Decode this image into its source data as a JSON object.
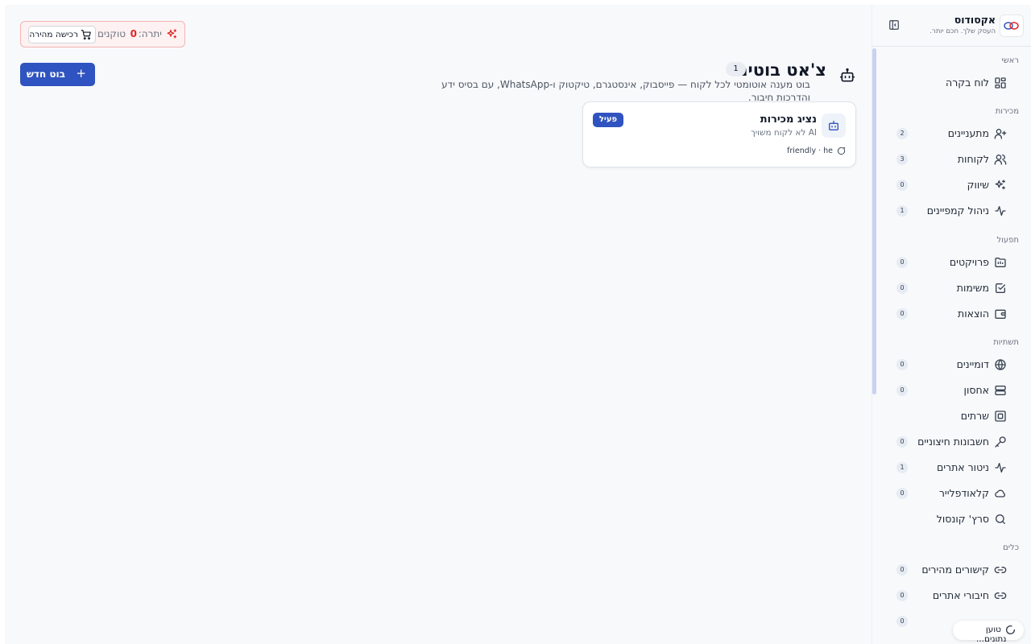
{
  "brand": {
    "name": "אקסודוס",
    "tagline": "העסק שלך. חכם יותר."
  },
  "token_bar": {
    "label": "יתרה:",
    "count": "0",
    "unit": "טוקנים",
    "buy_label": "רכישה מהירה"
  },
  "page": {
    "title": "צ'אט בוטים",
    "count_badge": "1",
    "description": "בוט מענה אוטומטי לכל לקוח — פייסבוק, אינסטגרם, טיקטוק ו-WhatsApp, עם בסיס ידע והדרכות חיבור.",
    "new_button_label": "בוט חדש"
  },
  "bot_card": {
    "name": "נציג מכירות",
    "subtitle": "AI לא לקוח משויך",
    "meta": "friendly · he",
    "status": "פעיל"
  },
  "sidebar": {
    "sections": [
      {
        "title": "ראשי"
      },
      {
        "title": "מכירות"
      },
      {
        "title": "תפעול"
      },
      {
        "title": "תשתיות"
      },
      {
        "title": "כלים"
      }
    ],
    "items": [
      {
        "label": "לוח בקרה",
        "icon": "dashboard-icon",
        "badge": ""
      },
      {
        "label": "מתעניינים",
        "icon": "user-plus-icon",
        "badge": "2"
      },
      {
        "label": "לקוחות",
        "icon": "users-icon",
        "badge": "3"
      },
      {
        "label": "שיווק",
        "icon": "sparkles-icon",
        "badge": "0"
      },
      {
        "label": "ניהול קמפיינים",
        "icon": "activity-icon",
        "badge": "1"
      },
      {
        "label": "פרויקטים",
        "icon": "folder-icon",
        "badge": "0"
      },
      {
        "label": "משימות",
        "icon": "check-square-icon",
        "badge": "0"
      },
      {
        "label": "הוצאות",
        "icon": "wallet-icon",
        "badge": "0"
      },
      {
        "label": "דומיינים",
        "icon": "globe-icon",
        "badge": "0"
      },
      {
        "label": "אחסון",
        "icon": "server-icon",
        "badge": "0"
      },
      {
        "label": "שרתים",
        "icon": "cpu-icon",
        "badge": ""
      },
      {
        "label": "חשבונות חיצוניים",
        "icon": "key-icon",
        "badge": "0"
      },
      {
        "label": "ניטור אתרים",
        "icon": "pulse-icon",
        "badge": "1"
      },
      {
        "label": "קלאודפלייר",
        "icon": "cloud-icon",
        "badge": "0"
      },
      {
        "label": "סרץ' קונסול",
        "icon": "search-icon",
        "badge": ""
      },
      {
        "label": "קישורים מהירים",
        "icon": "link-icon",
        "badge": "0"
      },
      {
        "label": "חיבורי אתרים",
        "icon": "link-icon",
        "badge": "0"
      }
    ],
    "extra_badge": "0"
  },
  "loading": {
    "label": "טוען",
    "sub": "נתונים..."
  },
  "colors": {
    "accent": "#2f53c0",
    "danger": "#dc2626",
    "badge_bg": "#e7ebf3"
  }
}
